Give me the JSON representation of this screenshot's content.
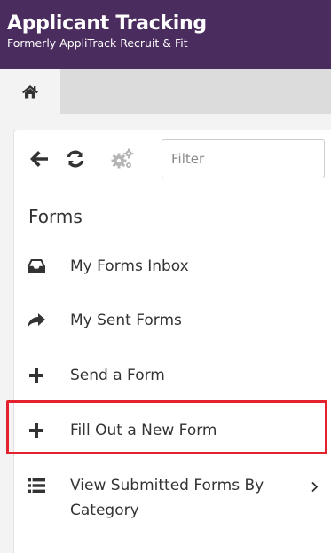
{
  "header": {
    "title": "Applicant Tracking",
    "subtitle": "Formerly AppliTrack Recruit & Fit"
  },
  "tabs": {
    "home_icon": "home-icon"
  },
  "toolbar": {
    "back_icon": "arrow-left-icon",
    "refresh_icon": "refresh-icon",
    "settings_icon": "gears-icon",
    "filter_placeholder": "Filter"
  },
  "section": {
    "title": "Forms"
  },
  "menu": [
    {
      "label": "My Forms Inbox",
      "icon": "inbox-icon"
    },
    {
      "label": "My Sent Forms",
      "icon": "share-arrow-icon"
    },
    {
      "label": "Send a Form",
      "icon": "plus-icon"
    },
    {
      "label": "Fill Out a New Form",
      "icon": "plus-icon",
      "highlighted": true
    },
    {
      "label_line1": "View Submitted Forms By",
      "label_line2": "Category",
      "icon": "list-icon",
      "has_submenu": true
    }
  ],
  "colors": {
    "header_bg": "#4b2c5e",
    "highlight_border": "#e4222e",
    "text": "#333333"
  }
}
